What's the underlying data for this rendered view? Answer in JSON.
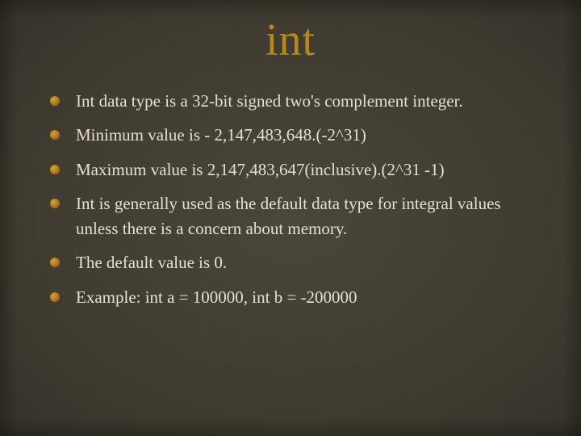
{
  "title": "int",
  "bullets": [
    "Int data type is a 32-bit signed two's complement integer.",
    "Minimum value is - 2,147,483,648.(-2^31)",
    "Maximum value is 2,147,483,647(inclusive).(2^31 -1)",
    "Int is generally used as the default data type for integral values unless there is a concern about memory.",
    "The default value is 0.",
    "Example: int a = 100000, int b = -200000"
  ]
}
